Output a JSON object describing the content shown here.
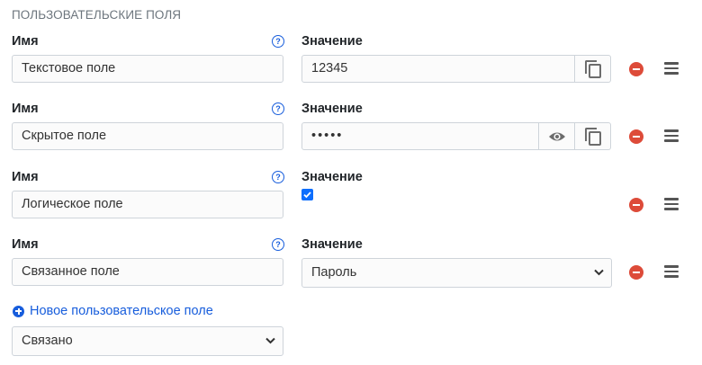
{
  "section_title": "ПОЛЬЗОВАТЕЛЬСКИЕ ПОЛЯ",
  "labels": {
    "name": "Имя",
    "value": "Значение",
    "help_glyph": "?"
  },
  "fields": [
    {
      "name": "Текстовое поле",
      "type": "text",
      "value": "12345"
    },
    {
      "name": "Скрытое поле",
      "type": "hidden",
      "value": "•••••"
    },
    {
      "name": "Логическое поле",
      "type": "boolean",
      "checked": true
    },
    {
      "name": "Связанное поле",
      "type": "linked",
      "value": "Пароль"
    }
  ],
  "new_field": {
    "link_label": "Новое пользовательское поле",
    "type_selected": "Связано"
  },
  "icons": {
    "help": "question-circle-icon",
    "copy": "copy-icon",
    "toggle_visibility": "eye-icon",
    "remove": "minus-circle-icon",
    "reorder": "drag-handle-icon",
    "add": "plus-circle-icon",
    "dropdown": "chevron-down-icon",
    "checkbox": "checkmark-icon"
  },
  "colors": {
    "accent": "#175ddc",
    "remove": "#dd4b39",
    "checkbox": "#0d6efd",
    "muted": "#6c757d"
  }
}
